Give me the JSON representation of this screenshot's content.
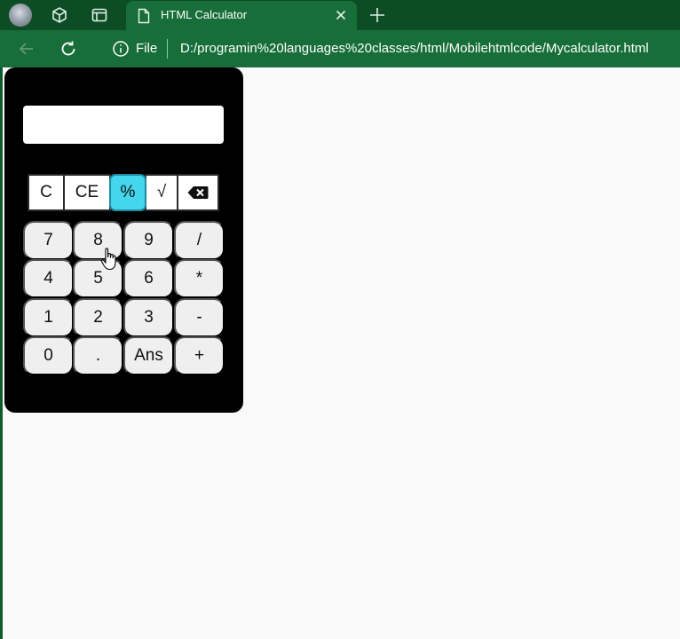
{
  "browser": {
    "tab": {
      "title": "HTML Calculator"
    },
    "toolbar": {
      "file_label": "File",
      "url": "D:/programin%20languages%20classes/html/Mobilehtmlcode/Mycalculator.html"
    }
  },
  "calculator": {
    "display_value": "",
    "function_row": [
      {
        "id": "clear",
        "label": "C"
      },
      {
        "id": "clear-entry",
        "label": "CE"
      },
      {
        "id": "percent",
        "label": "%"
      },
      {
        "id": "sqrt",
        "label": "√"
      },
      {
        "id": "backspace",
        "icon": "backspace-icon"
      }
    ],
    "keys": [
      [
        "7",
        "8",
        "9",
        "/"
      ],
      [
        "4",
        "5",
        "6",
        "*"
      ],
      [
        "1",
        "2",
        "3",
        "-"
      ],
      [
        "0",
        ".",
        "Ans",
        "+"
      ]
    ]
  },
  "colors": {
    "tab_strip": "#0c4d25",
    "toolbar": "#176e39",
    "calc_body": "#000000",
    "percent_highlight": "#43d6ec",
    "key_bg": "#efefef"
  }
}
